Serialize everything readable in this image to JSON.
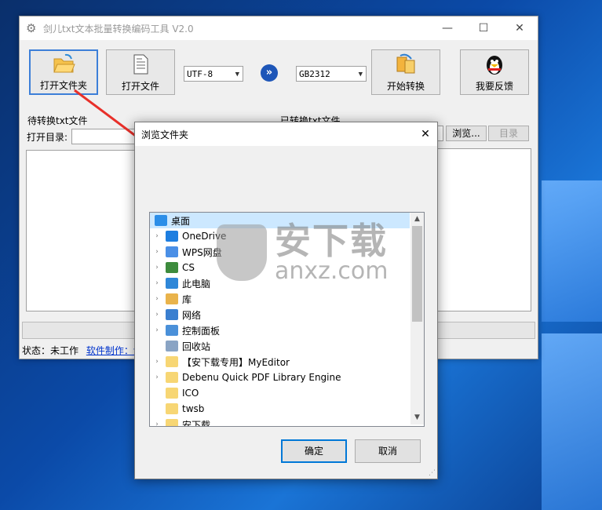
{
  "app": {
    "title": "剑儿txt文本批量转换编码工具 V2.0",
    "toolbar": {
      "open_folder": "打开文件夹",
      "open_file": "打开文件",
      "start_convert": "开始转换",
      "feedback": "我要反馈"
    },
    "source_encoding": "UTF-8",
    "target_encoding": "GB2312",
    "left_panel": {
      "label": "待转换txt文件",
      "open_dir_label": "打开目录:"
    },
    "right_panel": {
      "label": "已转换txt文件",
      "browse_button": "浏览...",
      "dir_button": "目录"
    },
    "status": {
      "label": "状态：未工作",
      "link": "软件制作：剑"
    }
  },
  "dialog": {
    "title": "浏览文件夹",
    "tree": [
      {
        "label": "桌面",
        "icon": "desktop-icon",
        "expander": false,
        "selected": true,
        "indent": 0
      },
      {
        "label": "OneDrive",
        "icon": "cloud-icon",
        "expander": true,
        "indent": 1
      },
      {
        "label": "WPS网盘",
        "icon": "cloud-outline-icon",
        "expander": true,
        "indent": 1
      },
      {
        "label": "CS",
        "icon": "user-icon",
        "expander": true,
        "indent": 1
      },
      {
        "label": "此电脑",
        "icon": "computer-icon",
        "expander": true,
        "indent": 1
      },
      {
        "label": "库",
        "icon": "library-icon",
        "expander": true,
        "indent": 1
      },
      {
        "label": "网络",
        "icon": "network-icon",
        "expander": true,
        "indent": 1
      },
      {
        "label": "控制面板",
        "icon": "control-panel-icon",
        "expander": true,
        "indent": 1
      },
      {
        "label": "回收站",
        "icon": "recycle-bin-icon",
        "expander": false,
        "indent": 1
      },
      {
        "label": "【安下载专用】MyEditor",
        "icon": "folder-icon",
        "expander": true,
        "indent": 1
      },
      {
        "label": "Debenu Quick PDF Library Engine",
        "icon": "folder-icon",
        "expander": true,
        "indent": 1
      },
      {
        "label": "ICO",
        "icon": "folder-icon",
        "expander": false,
        "indent": 1
      },
      {
        "label": "twsb",
        "icon": "folder-icon",
        "expander": false,
        "indent": 1
      },
      {
        "label": "安下载",
        "icon": "folder-icon",
        "expander": true,
        "indent": 1
      }
    ],
    "ok_button": "确定",
    "cancel_button": "取消"
  },
  "watermark": {
    "cn": "安下载",
    "en": "anxz.com"
  },
  "colors": {
    "accent": "#0078d7",
    "selection": "#cce8ff",
    "link": "#0033cc",
    "annotation_arrow": "#e8302a"
  }
}
